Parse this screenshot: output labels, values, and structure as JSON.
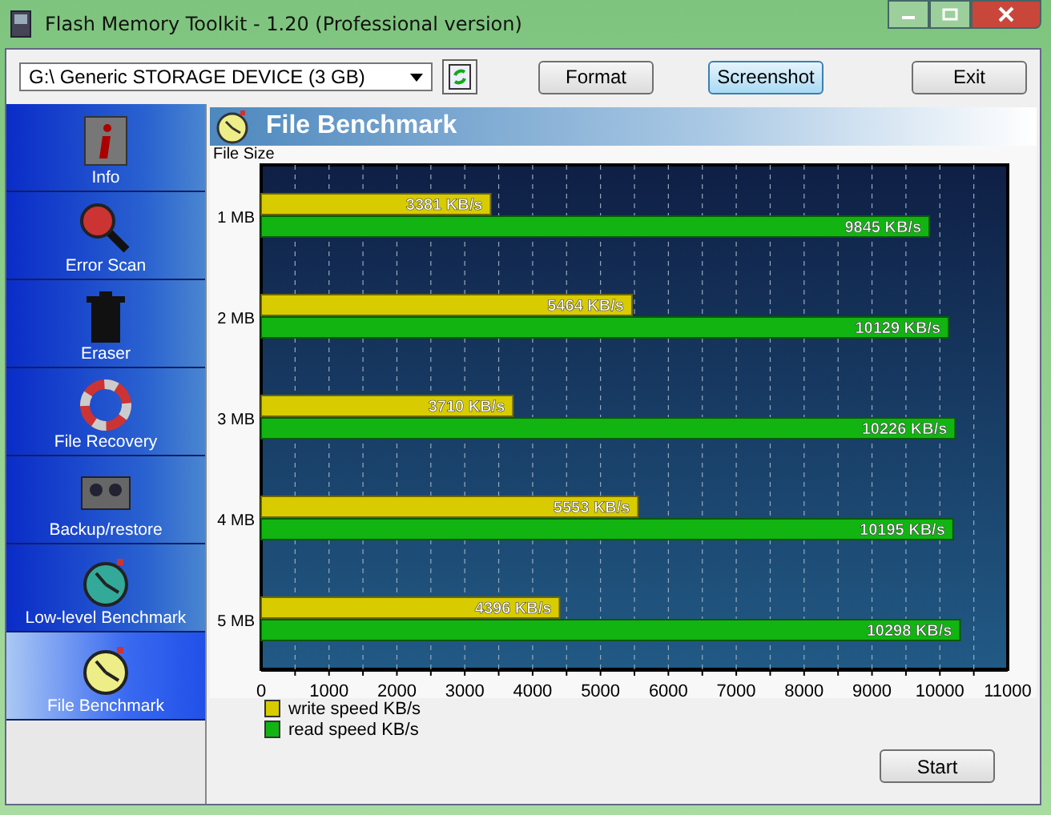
{
  "window": {
    "title": "Flash Memory Toolkit - 1.20 (Professional version)"
  },
  "toolbar": {
    "device": "G:\\ Generic STORAGE DEVICE (3 GB)",
    "buttons": [
      {
        "label": "Format",
        "selected": false
      },
      {
        "label": "Screenshot",
        "selected": true
      },
      {
        "label": "Exit",
        "selected": false
      }
    ]
  },
  "sidebar": {
    "items": [
      {
        "label": "Info",
        "selected": false
      },
      {
        "label": "Error Scan",
        "selected": false
      },
      {
        "label": "Eraser",
        "selected": false
      },
      {
        "label": "File Recovery",
        "selected": false
      },
      {
        "label": "Backup/restore",
        "selected": false
      },
      {
        "label": "Low-level Benchmark",
        "selected": false
      },
      {
        "label": "File Benchmark",
        "selected": true
      }
    ]
  },
  "panel": {
    "title": "File Benchmark",
    "chart_data": {
      "type": "bar",
      "orientation": "horizontal",
      "grid": true,
      "ylabel": "File Size",
      "categories": [
        "1 MB",
        "2 MB",
        "3 MB",
        "4 MB",
        "5 MB"
      ],
      "xlim": [
        0,
        11000
      ],
      "xticks": [
        0,
        1000,
        2000,
        3000,
        4000,
        5000,
        6000,
        7000,
        8000,
        9000,
        10000,
        11000
      ],
      "series": [
        {
          "name": "write speed KB/s",
          "color": "#d8cc00",
          "values": [
            3381,
            5464,
            3710,
            5553,
            4396
          ],
          "value_labels": [
            "3381 KB/s",
            "5464 KB/s",
            "3710 KB/s",
            "5553 KB/s",
            "4396 KB/s"
          ]
        },
        {
          "name": "read speed KB/s",
          "color": "#12b412",
          "values": [
            9845,
            10129,
            10226,
            10195,
            10298
          ],
          "value_labels": [
            "9845 KB/s",
            "10129 KB/s",
            "10226 KB/s",
            "10195 KB/s",
            "10298 KB/s"
          ]
        }
      ]
    },
    "start_button": "Start"
  }
}
